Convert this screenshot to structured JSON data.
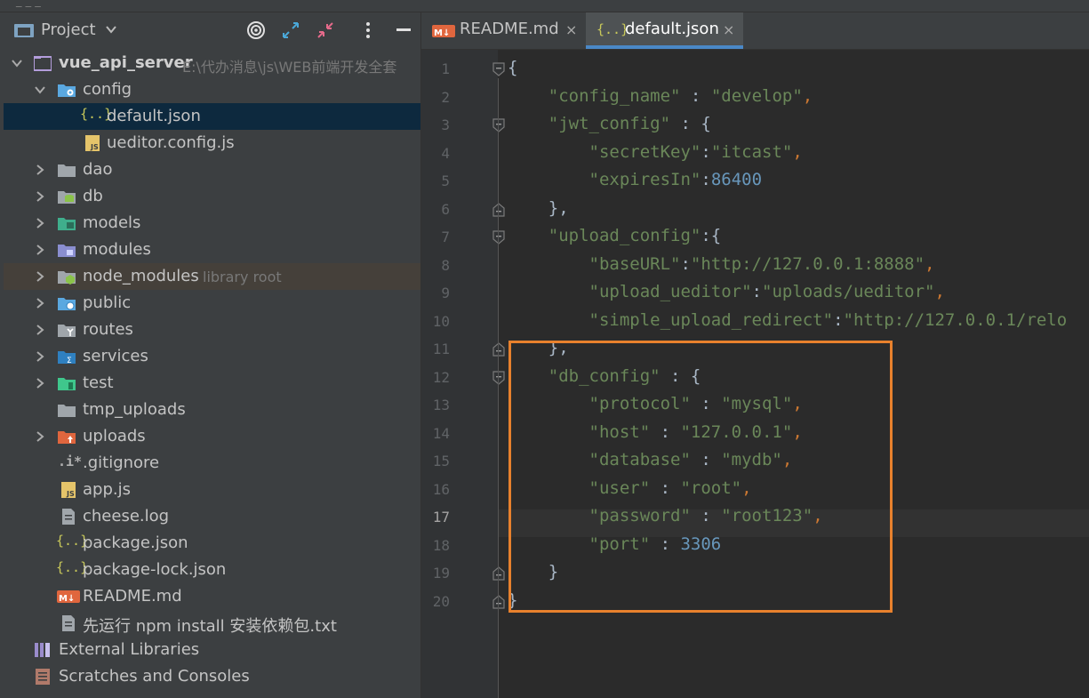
{
  "project_panel": {
    "title": "Project",
    "tree": [
      {
        "label": "vue_api_server",
        "muted": "E:\\代办消息\\js\\WEB前端开发全套"
      },
      {
        "label": "config"
      },
      {
        "label": "default.json"
      },
      {
        "label": "ueditor.config.js"
      },
      {
        "label": "dao"
      },
      {
        "label": "db"
      },
      {
        "label": "models"
      },
      {
        "label": "modules"
      },
      {
        "label": "node_modules",
        "muted": "library root"
      },
      {
        "label": "public"
      },
      {
        "label": "routes"
      },
      {
        "label": "services"
      },
      {
        "label": "test"
      },
      {
        "label": "tmp_uploads"
      },
      {
        "label": "uploads"
      },
      {
        "label": ".gitignore"
      },
      {
        "label": "app.js"
      },
      {
        "label": "cheese.log"
      },
      {
        "label": "package.json"
      },
      {
        "label": "package-lock.json"
      },
      {
        "label": "README.md"
      },
      {
        "label": "先运行 npm install 安装依赖包.txt"
      },
      {
        "label": "External Libraries"
      },
      {
        "label": "Scratches and Consoles"
      }
    ]
  },
  "editor": {
    "tabs": [
      {
        "label": "README.md"
      },
      {
        "label": "default.json"
      }
    ],
    "close_glyph": "×",
    "line_numbers": [
      "1",
      "2",
      "3",
      "4",
      "5",
      "6",
      "7",
      "8",
      "9",
      "10",
      "11",
      "12",
      "13",
      "14",
      "15",
      "16",
      "17",
      "18",
      "19",
      "20"
    ],
    "current_line": "17",
    "code": [
      {
        "t": [
          [
            "b",
            "{"
          ]
        ]
      },
      {
        "t": [
          [
            "b",
            "    "
          ],
          [
            "s",
            "\"config_name\""
          ],
          [
            "b",
            " : "
          ],
          [
            "s",
            "\"develop\""
          ],
          [
            "p",
            ","
          ]
        ]
      },
      {
        "t": [
          [
            "b",
            "    "
          ],
          [
            "s",
            "\"jwt_config\""
          ],
          [
            "b",
            " : {"
          ]
        ]
      },
      {
        "t": [
          [
            "b",
            "        "
          ],
          [
            "s",
            "\"secretKey\""
          ],
          [
            "b",
            ":"
          ],
          [
            "s",
            "\"itcast\""
          ],
          [
            "p",
            ","
          ]
        ]
      },
      {
        "t": [
          [
            "b",
            "        "
          ],
          [
            "s",
            "\"expiresIn\""
          ],
          [
            "b",
            ":"
          ],
          [
            "n",
            "86400"
          ]
        ]
      },
      {
        "t": [
          [
            "b",
            "    },"
          ]
        ]
      },
      {
        "t": [
          [
            "b",
            "    "
          ],
          [
            "s",
            "\"upload_config\""
          ],
          [
            "b",
            ":{"
          ]
        ]
      },
      {
        "t": [
          [
            "b",
            "        "
          ],
          [
            "s",
            "\"baseURL\""
          ],
          [
            "b",
            ":"
          ],
          [
            "s",
            "\"http://127.0.0.1:8888\""
          ],
          [
            "p",
            ","
          ]
        ]
      },
      {
        "t": [
          [
            "b",
            "        "
          ],
          [
            "s",
            "\"upload_ueditor\""
          ],
          [
            "b",
            ":"
          ],
          [
            "s",
            "\"uploads/ueditor\""
          ],
          [
            "p",
            ","
          ]
        ]
      },
      {
        "t": [
          [
            "b",
            "        "
          ],
          [
            "s",
            "\"simple_upload_redirect\""
          ],
          [
            "b",
            ":"
          ],
          [
            "s",
            "\"http://127.0.0.1/relo"
          ]
        ]
      },
      {
        "t": [
          [
            "b",
            "    },"
          ]
        ]
      },
      {
        "t": [
          [
            "b",
            "    "
          ],
          [
            "s",
            "\"db_config\""
          ],
          [
            "b",
            " : {"
          ]
        ]
      },
      {
        "t": [
          [
            "b",
            "        "
          ],
          [
            "s",
            "\"protocol\""
          ],
          [
            "b",
            " : "
          ],
          [
            "s",
            "\"mysql\""
          ],
          [
            "p",
            ","
          ]
        ]
      },
      {
        "t": [
          [
            "b",
            "        "
          ],
          [
            "s",
            "\"host\""
          ],
          [
            "b",
            " : "
          ],
          [
            "s",
            "\"127.0.0.1\""
          ],
          [
            "p",
            ","
          ]
        ]
      },
      {
        "t": [
          [
            "b",
            "        "
          ],
          [
            "s",
            "\"database\""
          ],
          [
            "b",
            " : "
          ],
          [
            "s",
            "\"mydb\""
          ],
          [
            "p",
            ","
          ]
        ]
      },
      {
        "t": [
          [
            "b",
            "        "
          ],
          [
            "s",
            "\"user\""
          ],
          [
            "b",
            " : "
          ],
          [
            "s",
            "\"root\""
          ],
          [
            "p",
            ","
          ]
        ]
      },
      {
        "t": [
          [
            "b",
            "        "
          ],
          [
            "s",
            "\"password\""
          ],
          [
            "b",
            " : "
          ],
          [
            "s",
            "\"root123\""
          ],
          [
            "p",
            ","
          ]
        ]
      },
      {
        "t": [
          [
            "b",
            "        "
          ],
          [
            "s",
            "\"port\""
          ],
          [
            "b",
            " : "
          ],
          [
            "n",
            "3306"
          ]
        ]
      },
      {
        "t": [
          [
            "b",
            "    }"
          ]
        ]
      },
      {
        "t": [
          [
            "b",
            "}"
          ]
        ]
      }
    ]
  },
  "icons": {
    "project_panel": [
      "project-folder-icon",
      "chevron-down-icon",
      "target-icon",
      "expand-icon",
      "collapse-icon",
      "more-vertical-icon",
      "minimize-icon"
    ],
    "tree": [
      "folder-icon",
      "config-folder-icon",
      "json-icon",
      "js-icon",
      "database-folder-icon",
      "models-folder-icon",
      "modules-folder-icon",
      "node-folder-icon",
      "web-folder-icon",
      "routes-folder-icon",
      "services-folder-icon",
      "test-folder-icon",
      "uploads-folder-icon",
      "gitignore-icon",
      "text-file-icon",
      "markdown-icon",
      "library-icon",
      "scratches-icon"
    ]
  },
  "colors": {
    "highlight_box": "#e8812d",
    "json_key": "#6a8759",
    "number": "#6897bb",
    "selection": "#0d293e"
  }
}
